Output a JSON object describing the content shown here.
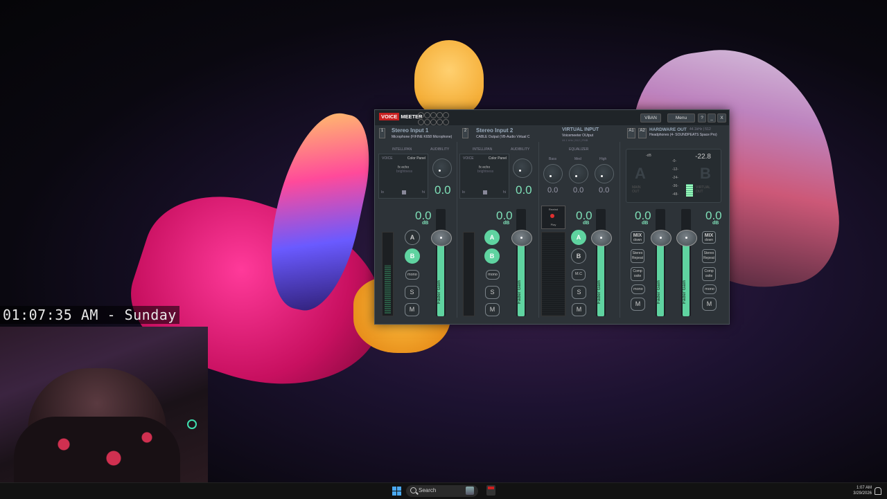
{
  "overlay": {
    "clock": "01:07:35 AM - Sunday"
  },
  "voicemeeter": {
    "logo_voice": "VOICE",
    "logo_meeter": "MEETER",
    "registers": [
      "R",
      "R",
      "R",
      "R",
      "R",
      "R",
      "R",
      "R",
      "R",
      "R"
    ],
    "vban_label": "VBAN",
    "menu_label": "Menu",
    "help_label": "?",
    "minimize_label": "_",
    "close_label": "X",
    "strips": [
      {
        "num": "1",
        "title": "Stereo Input 1",
        "device": "Microphone (FIFINE K658 Microphone)",
        "intellipan": "INTELLIPAN",
        "audibility": "AUDIBILITY",
        "voice": "VOICE",
        "color_panel": "Color Panel",
        "fx_echo": "fx echo",
        "brightness": "brightness",
        "lo": "lo",
        "hi": "hi",
        "aud_value": "0.0",
        "fader_value": "0.0",
        "db": "dB",
        "a_label": "A",
        "b_label": "B",
        "mono": "mono",
        "s_label": "S",
        "m_label": "M",
        "fader_label": "Fader Gain",
        "a_on": false,
        "b_on": true
      },
      {
        "num": "2",
        "title": "Stereo Input 2",
        "device": "CABLE Output (VB-Audio Virtual C",
        "intellipan": "INTELLIPAN",
        "audibility": "AUDIBILITY",
        "voice": "VOICE",
        "color_panel": "Color Panel",
        "fx_echo": "fx echo",
        "brightness": "brightness",
        "lo": "lo",
        "hi": "hi",
        "aud_value": "0.0",
        "fader_value": "0.0",
        "db": "dB",
        "a_label": "A",
        "b_label": "B",
        "mono": "mono",
        "s_label": "S",
        "m_label": "M",
        "fader_label": "Fader Gain",
        "a_on": true,
        "b_on": true
      }
    ],
    "virtual": {
      "title": "VIRTUAL INPUT",
      "device": "Voicemeeter OUtput",
      "sub": "44.1 kHz | 512 | FMB",
      "equalizer": "EQUALIZER",
      "bass": "Bass",
      "med": "Med",
      "high": "High",
      "bass_val": "0.0",
      "med_val": "0.0",
      "high_val": "0.0",
      "fader_value": "0.0",
      "db": "dB",
      "a_label": "A",
      "b_label": "B",
      "mc": "M.C",
      "s_label": "S",
      "m_label": "M",
      "fader_label": "Fader Gain",
      "tape_top": "Rewind",
      "tape_bottom": "Play"
    },
    "hardware": {
      "a1": "A1",
      "a2": "A2",
      "title": "HARDWARE OUT",
      "rate": "44.1kHz | 512",
      "device": "Headphones (4- SOUNDPEATS Space Pro)",
      "meter_db": "-22.8",
      "meter_db2": "-dB",
      "scale": [
        "-0-",
        "-12-",
        "-24-",
        "-36-",
        "-48-"
      ],
      "a_big": "A",
      "b_big": "B",
      "main_out": "MAIN OUT",
      "virtual_out": "VIRTUAL OUT",
      "fader1_value": "0.0",
      "fader2_value": "0.0",
      "db": "dB",
      "mix": "MIX",
      "down": "down",
      "stereo_repeat": "Stereo Repeat",
      "composite": "Comp osite",
      "mono": "mono",
      "m_label": "M",
      "fader_label": "Fader Gain"
    }
  },
  "taskbar": {
    "search_label": "Search",
    "time": "1:07 AM",
    "date": "3/29/2026"
  }
}
